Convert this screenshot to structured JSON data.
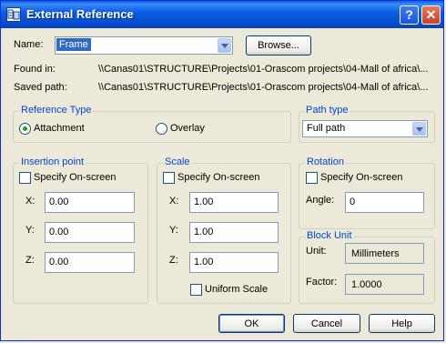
{
  "window": {
    "title": "External Reference",
    "help_button": "?",
    "close_button": "✕"
  },
  "name": {
    "label": "Name:",
    "value": "Frame",
    "browse_label": "Browse..."
  },
  "found_in": {
    "label": "Found in:",
    "value": "\\\\Canas01\\STRUCTURE\\Projects\\01-Orascom projects\\04-Mall of africa\\..."
  },
  "saved_path": {
    "label": "Saved path:",
    "value": "\\\\Canas01\\STRUCTURE\\Projects\\01-Orascom projects\\04-Mall of africa\\..."
  },
  "reference_type": {
    "title": "Reference Type",
    "attachment_label": "Attachment",
    "overlay_label": "Overlay",
    "selected": "Attachment"
  },
  "path_type": {
    "title": "Path type",
    "value": "Full path"
  },
  "insertion": {
    "title": "Insertion point",
    "specify_label": "Specify On-screen",
    "specify_checked": false,
    "x_label": "X:",
    "x": "0.00",
    "y_label": "Y:",
    "y": "0.00",
    "z_label": "Z:",
    "z": "0.00"
  },
  "scale": {
    "title": "Scale",
    "specify_label": "Specify On-screen",
    "specify_checked": false,
    "x_label": "X:",
    "x": "1.00",
    "y_label": "Y:",
    "y": "1.00",
    "z_label": "Z:",
    "z": "1.00",
    "uniform_label": "Uniform Scale",
    "uniform_checked": false
  },
  "rotation": {
    "title": "Rotation",
    "specify_label": "Specify On-screen",
    "specify_checked": false,
    "angle_label": "Angle:",
    "angle": "0"
  },
  "block_unit": {
    "title": "Block Unit",
    "unit_label": "Unit:",
    "unit": "Millimeters",
    "factor_label": "Factor:",
    "factor": "1.0000"
  },
  "buttons": {
    "ok": "OK",
    "cancel": "Cancel",
    "help": "Help"
  },
  "colors": {
    "titlebar": "#0a5ee6",
    "group_title": "#0046d5",
    "face": "#ece9d8",
    "selection": "#316ac5"
  }
}
